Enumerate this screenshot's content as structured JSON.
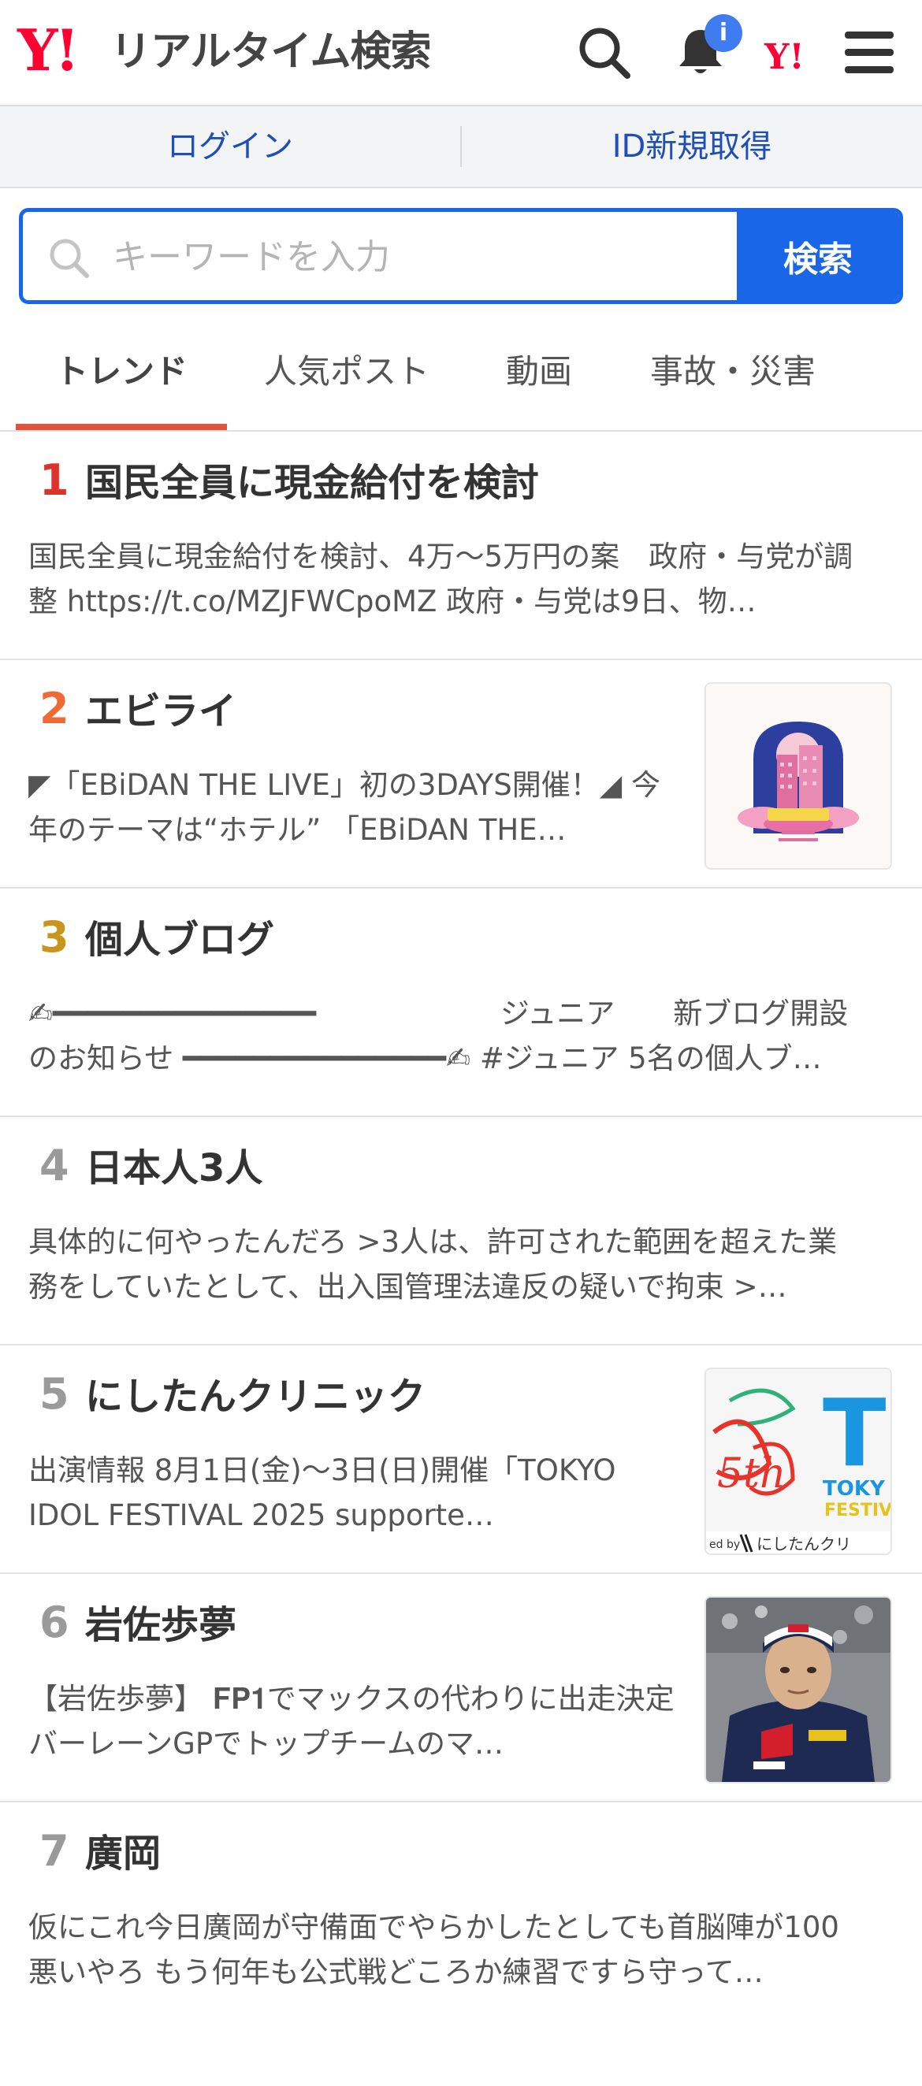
{
  "header": {
    "logo_mark": "Y!",
    "logo_title": "リアルタイム検索",
    "notification_count": "i",
    "yahoo_mark": "Y!"
  },
  "auth": {
    "login_label": "ログイン",
    "signup_label": "ID新規取得"
  },
  "search": {
    "placeholder": "キーワードを入力",
    "value": "",
    "button_label": "検索"
  },
  "tabs": [
    {
      "label": "トレンド",
      "active": true
    },
    {
      "label": "人気ポスト",
      "active": false
    },
    {
      "label": "動画",
      "active": false
    },
    {
      "label": "事故・災害",
      "active": false
    }
  ],
  "rank_colors": {
    "1": "#e0322d",
    "2": "#ef6a34",
    "3": "#c8961c",
    "other": "#9a9a9a"
  },
  "trends": [
    {
      "rank": "1",
      "title": "国民全員に現金給付を検討",
      "desc": "国民全員に現金給付を検討、4万～5万円の案　政府・与党が調整 https://t.co/MZJFWCpoMZ 政府・与党は9日、物…"
    },
    {
      "rank": "2",
      "title": "エビライ",
      "desc": "◤「EBiDAN THE LIVE」初の3DAYS開催！◢ 今年のテーマは“ホテル” 「EBiDAN THE…",
      "thumb": "hotel-poster"
    },
    {
      "rank": "3",
      "title": "個人ブログ",
      "desc": "✍︎━━━━━━━━━━━━━━━ 　　　　　　ジュニア　　新ブログ開設のお知らせ ━━━━━━━━━━━━━━━✍︎ #ジュニア 5名の個人ブ…"
    },
    {
      "rank": "4",
      "title": "日本人3人",
      "desc": "具体的に何やったんだろ >3人は、許可された範囲を超えた業務をしていたとして、出入国管理法違反の疑いで拘束 >…"
    },
    {
      "rank": "5",
      "title": "にしたんクリニック",
      "desc": "出演情報 8月1日(金)～3日(日)開催「TOKYO IDOL FESTIVAL 2025 supporte…",
      "thumb": "festival-banner"
    },
    {
      "rank": "6",
      "title": "岩佐歩夢",
      "desc": "【岩佐歩夢】 𝐅𝐏𝟏でマックスの代わりに出走決定 バーレーンGPでトップチームのマ…",
      "thumb": "driver-photo"
    },
    {
      "rank": "7",
      "title": "廣岡",
      "desc": "仮にこれ今日廣岡が守備面でやらかしたとしても首脳陣が100悪いやろ もう何年も公式戦どころか練習ですら守って…"
    }
  ],
  "thumb_texts": {
    "festival_logo": "T",
    "festival_name": "TOKY",
    "festival_sub": "FESTIV",
    "festival_sponsor": "ed by",
    "festival_sponsor_name": "にしたんクリ"
  }
}
